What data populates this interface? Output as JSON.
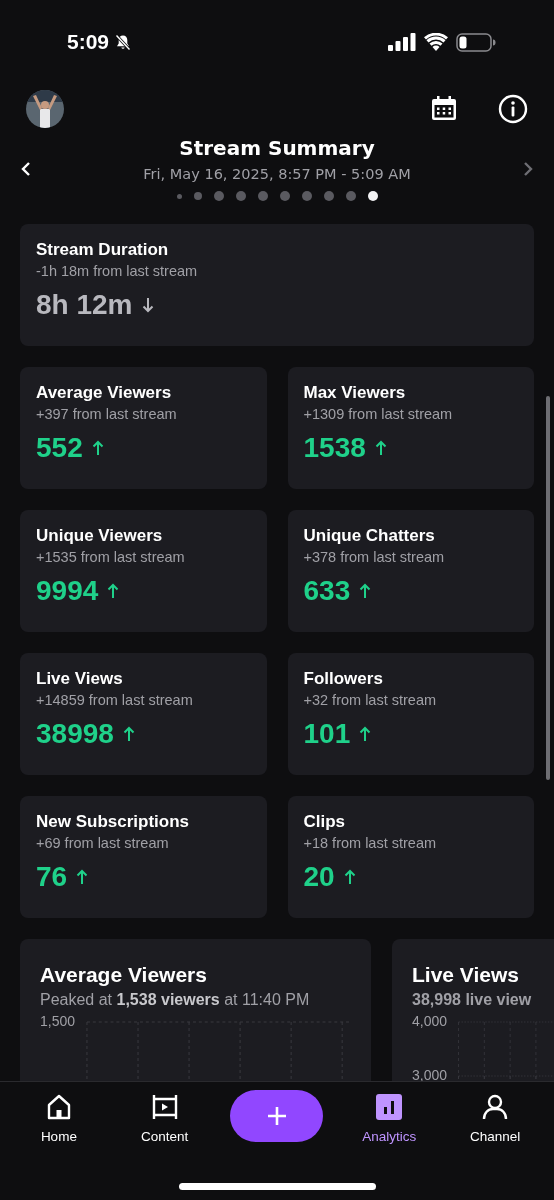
{
  "status_bar": {
    "time": "5:09",
    "silent": true
  },
  "header": {
    "title": "Stream Summary",
    "date_range": "Fri, May 16, 2025, 8:57 PM - 5:09 AM",
    "pages": [
      {
        "selected": false
      },
      {
        "selected": false
      },
      {
        "selected": false
      },
      {
        "selected": false
      },
      {
        "selected": false
      },
      {
        "selected": false
      },
      {
        "selected": false
      },
      {
        "selected": false
      },
      {
        "selected": false
      },
      {
        "selected": true
      }
    ]
  },
  "duration": {
    "label": "Stream Duration",
    "change": "-1h 18m from last stream",
    "value": "8h 12m",
    "increased": false
  },
  "stats": [
    {
      "label": "Average Viewers",
      "change": "+397 from last stream",
      "value": "552",
      "increased": true
    },
    {
      "label": "Max Viewers",
      "change": "+1309 from last stream",
      "value": "1538",
      "increased": true
    },
    {
      "label": "Unique Viewers",
      "change": "+1535 from last stream",
      "value": "9994",
      "increased": true
    },
    {
      "label": "Unique Chatters",
      "change": "+378 from last stream",
      "value": "633",
      "increased": true
    },
    {
      "label": "Live Views",
      "change": "+14859 from last stream",
      "value": "38998",
      "increased": true
    },
    {
      "label": "Followers",
      "change": "+32 from last stream",
      "value": "101",
      "increased": true
    },
    {
      "label": "New Subscriptions",
      "change": "+69 from last stream",
      "value": "76",
      "increased": true
    },
    {
      "label": "Clips",
      "change": "+18 from last stream",
      "value": "20",
      "increased": true
    }
  ],
  "chart_cards": [
    {
      "title": "Average Viewers",
      "subtitle": "Peaked at **1,538 viewers** at 11:40 PM",
      "axis_labels": [
        "1,500"
      ]
    },
    {
      "title": "Live Views",
      "subtitle": "38,998 live view",
      "axis_labels": [
        "4,000",
        "3,000"
      ]
    }
  ],
  "nav": [
    {
      "kind": "tab",
      "label": "Home",
      "selected": false
    },
    {
      "kind": "tab",
      "label": "Content",
      "selected": false
    },
    {
      "kind": "create"
    },
    {
      "kind": "tab",
      "label": "Analytics",
      "selected": true
    },
    {
      "kind": "tab",
      "label": "Channel",
      "selected": false
    }
  ]
}
